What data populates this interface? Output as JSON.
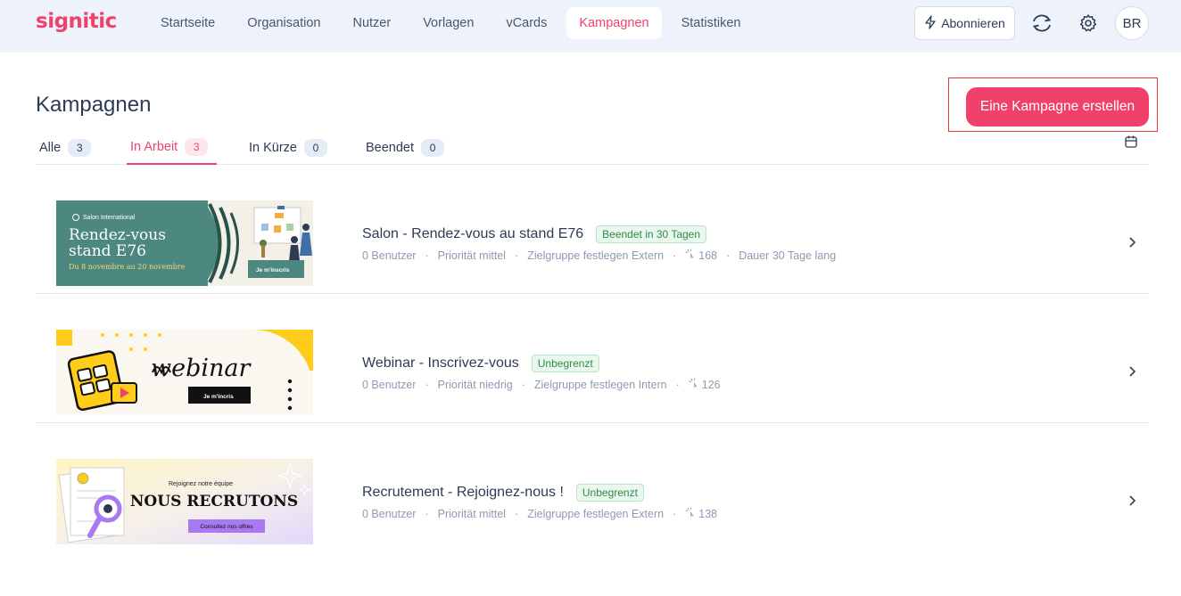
{
  "brand": {
    "logo": "signitic",
    "accent": "#f0416b"
  },
  "nav": [
    {
      "label": "Startseite"
    },
    {
      "label": "Organisation"
    },
    {
      "label": "Nutzer"
    },
    {
      "label": "Vorlagen"
    },
    {
      "label": "vCards"
    },
    {
      "label": "Kampagnen",
      "active": true
    },
    {
      "label": "Statistiken"
    }
  ],
  "header_actions": {
    "subscribe_label": "Abonnieren",
    "avatar_initials": "BR"
  },
  "page": {
    "title": "Kampagnen",
    "create_label": "Eine Kampagne erstellen"
  },
  "tabs": [
    {
      "label": "Alle",
      "count": "3"
    },
    {
      "label": "In Arbeit",
      "count": "3",
      "active": true
    },
    {
      "label": "In Kürze",
      "count": "0"
    },
    {
      "label": "Beendet",
      "count": "0"
    }
  ],
  "campaigns": [
    {
      "title": "Salon - Rendez-vous au stand E76",
      "badge": "Beendet in 30 Tagen",
      "meta": [
        "0 Benutzer",
        "Priorität mittel",
        "Zielgruppe festlegen Extern",
        "168",
        "Dauer 30 Tage lang"
      ],
      "banner": {
        "brand": "Salon International",
        "line1": "Rendez-vous",
        "line2": "stand E76",
        "dates": "Du 8 novembre au 20 novembre",
        "cta": "Je m'inscris",
        "colors": {
          "bg_left": "#4d8880",
          "bg_right": "#f3f0e7"
        }
      }
    },
    {
      "title": "Webinar - Inscrivez-vous",
      "badge": "Unbegrenzt",
      "meta": [
        "0 Benutzer",
        "Priorität niedrig",
        "Zielgruppe festlegen Intern",
        "126"
      ],
      "banner": {
        "word": "webinar",
        "cta": "Je m'incris",
        "colors": {
          "bg": "#faf7f0",
          "yellow": "#ffcc1a"
        }
      }
    },
    {
      "title": "Recrutement - Rejoignez-nous !",
      "badge": "Unbegrenzt",
      "meta": [
        "0 Benutzer",
        "Priorität mittel",
        "Zielgruppe festlegen Extern",
        "138"
      ],
      "banner": {
        "kicker": "Rejoignez notre équipe",
        "headline": "NOUS RECRUTONS",
        "cta": "Consultez nos offres",
        "colors": {
          "purple": "#a879f0"
        }
      }
    }
  ]
}
